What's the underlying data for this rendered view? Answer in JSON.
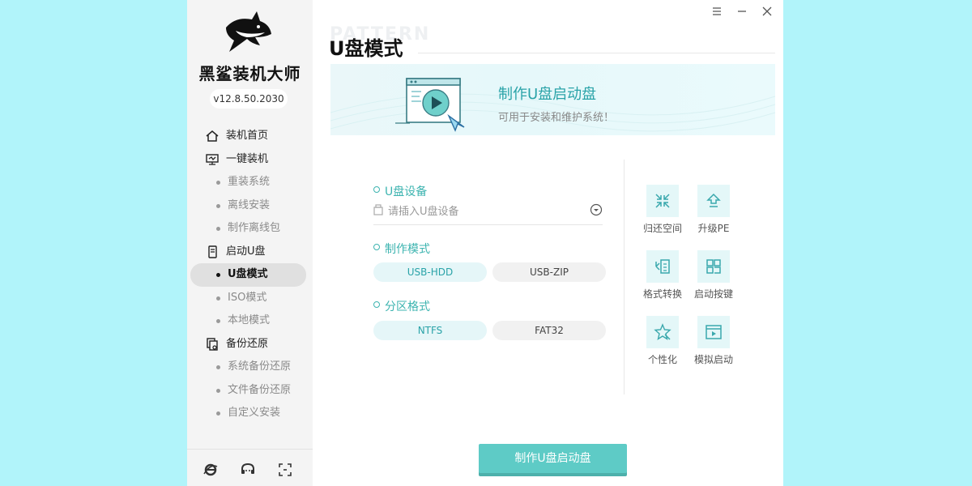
{
  "sidebar": {
    "brand": "黑鲨装机大师",
    "version": "v12.8.50.2030",
    "nav": [
      {
        "label": "装机首页",
        "type": "main",
        "icon": "home-icon"
      },
      {
        "label": "一键装机",
        "type": "main",
        "icon": "monitor-icon"
      },
      {
        "label": "重装系统",
        "type": "sub"
      },
      {
        "label": "离线安装",
        "type": "sub"
      },
      {
        "label": "制作离线包",
        "type": "sub"
      },
      {
        "label": "启动U盘",
        "type": "main",
        "icon": "usb-drive-icon"
      },
      {
        "label": "U盘模式",
        "type": "sub",
        "active": true
      },
      {
        "label": "ISO模式",
        "type": "sub"
      },
      {
        "label": "本地模式",
        "type": "sub"
      },
      {
        "label": "备份还原",
        "type": "main",
        "icon": "backup-icon"
      },
      {
        "label": "系统备份还原",
        "type": "sub"
      },
      {
        "label": "文件备份还原",
        "type": "sub"
      },
      {
        "label": "自定义安装",
        "type": "sub"
      }
    ]
  },
  "main": {
    "watermark": "PATTERN",
    "title": "U盘模式",
    "banner": {
      "title": "制作U盘启动盘",
      "subtitle": "可用于安装和维护系统！"
    },
    "device": {
      "label": "U盘设备",
      "placeholder": "请插入U盘设备"
    },
    "mode": {
      "label": "制作模式",
      "options": [
        "USB-HDD",
        "USB-ZIP"
      ],
      "selected": "USB-HDD"
    },
    "partition": {
      "label": "分区格式",
      "options": [
        "NTFS",
        "FAT32"
      ],
      "selected": "NTFS"
    },
    "tools": [
      {
        "label": "归还空间",
        "icon": "shrink-arrows-icon"
      },
      {
        "label": "升级PE",
        "icon": "upgrade-arrow-icon"
      },
      {
        "label": "格式转换",
        "icon": "format-convert-icon"
      },
      {
        "label": "启动按键",
        "icon": "boot-key-icon"
      },
      {
        "label": "个性化",
        "icon": "personalize-icon"
      },
      {
        "label": "模拟启动",
        "icon": "simulate-boot-icon"
      }
    ],
    "primary_button": "制作U盘启动盘"
  },
  "colors": {
    "accent": "#3db4b0",
    "button": "#5ecbc6",
    "background": "#b1f4fa"
  }
}
